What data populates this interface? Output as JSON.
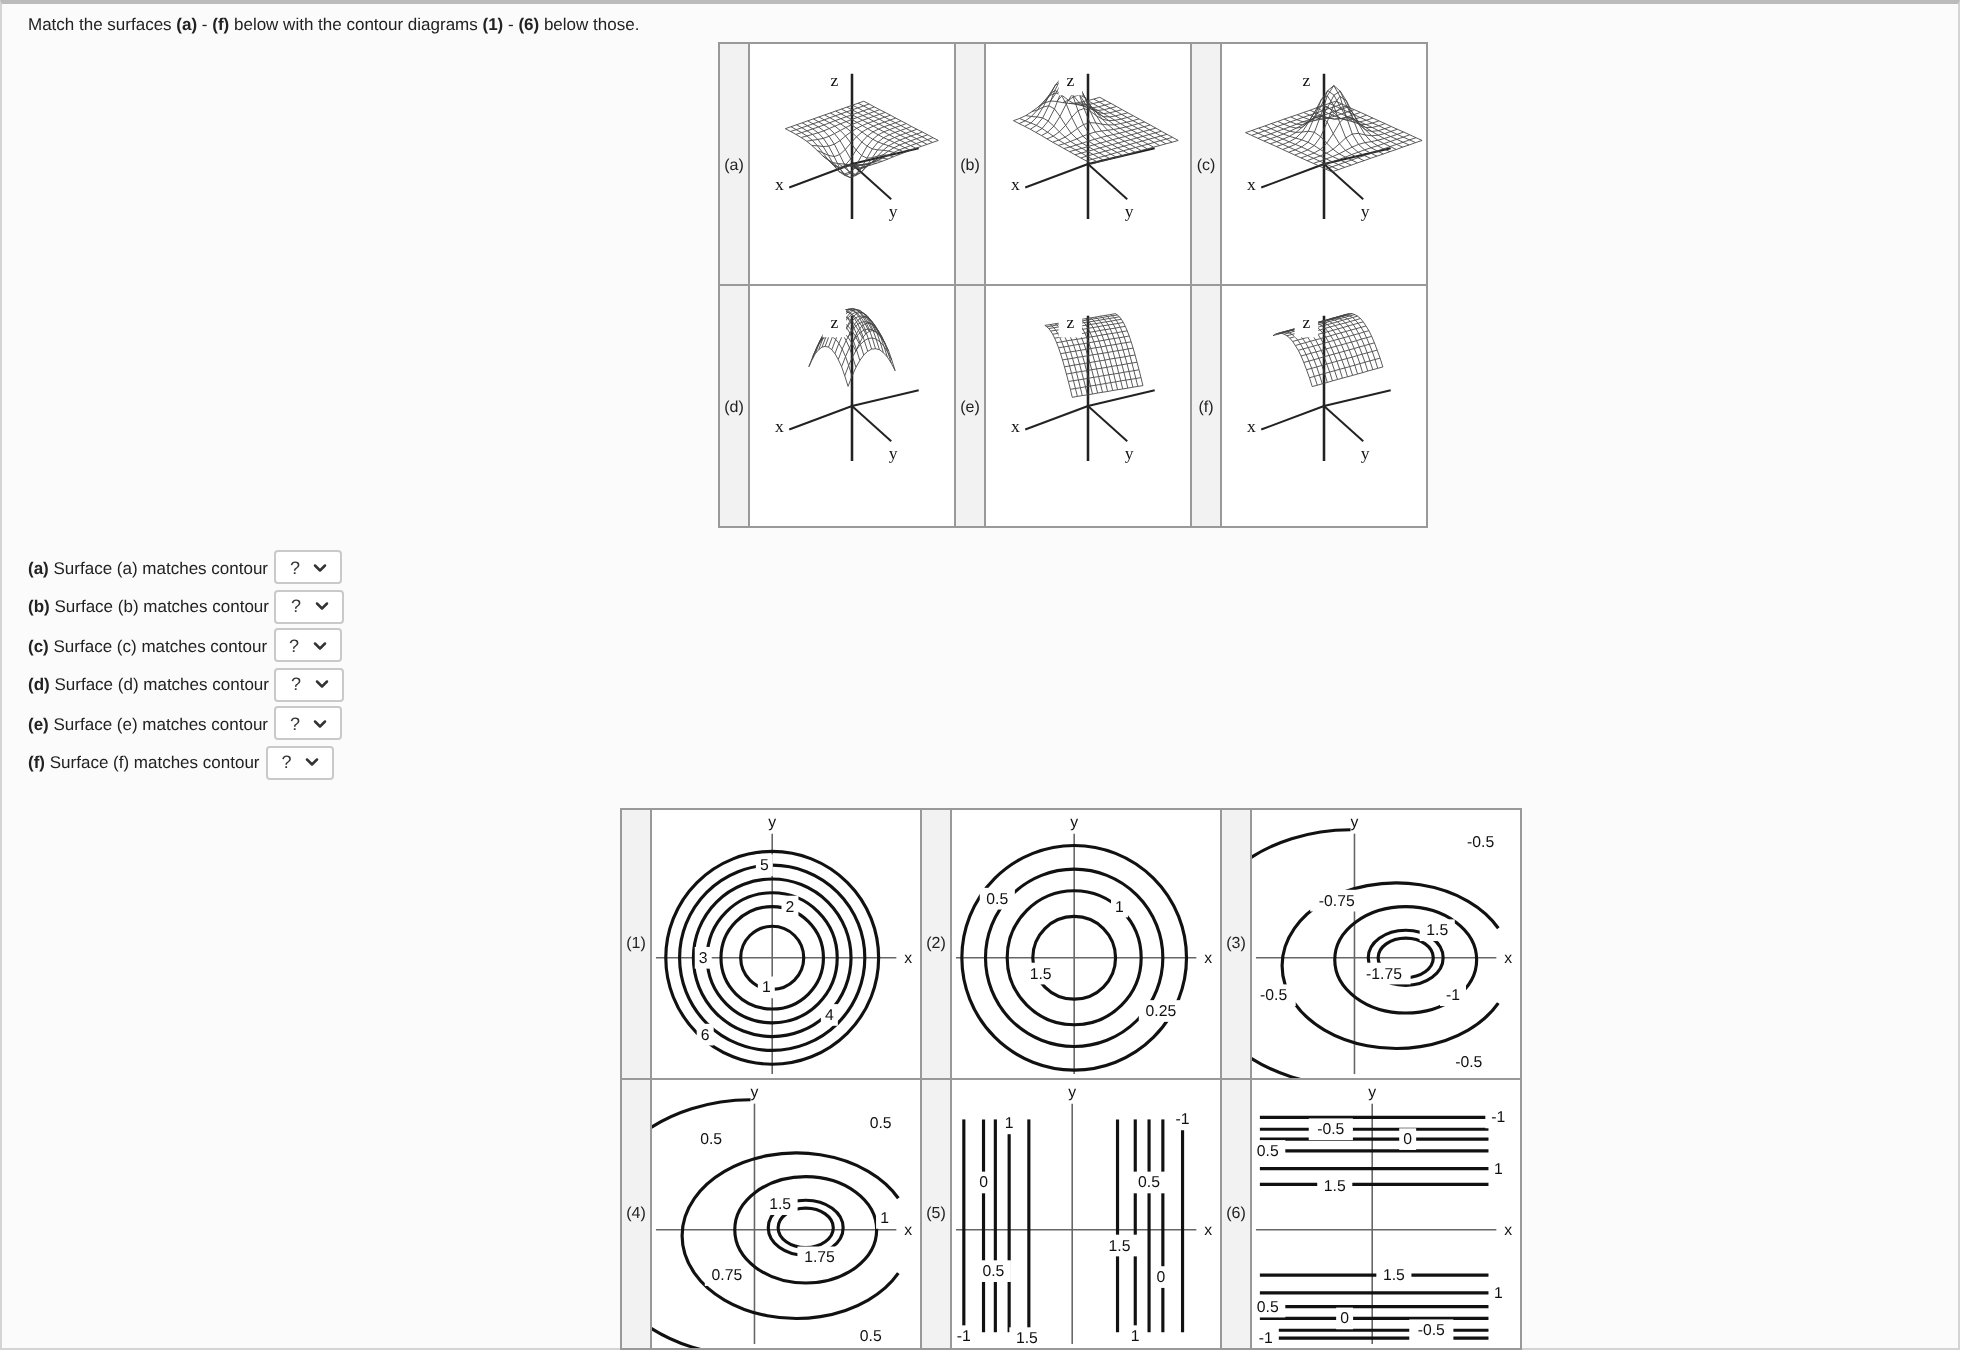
{
  "instruction": "Match the surfaces **(a)** - **(f)** below with the contour diagrams **(1)** - **(6)** below those.",
  "surfaces": [
    {
      "label": "(a)",
      "kind": "dip",
      "axis_labels": {
        "z": "z",
        "x": "x",
        "y": "y"
      }
    },
    {
      "label": "(b)",
      "kind": "offset-peak",
      "axis_labels": {
        "z": "z",
        "x": "x",
        "y": "y"
      }
    },
    {
      "label": "(c)",
      "kind": "peak",
      "axis_labels": {
        "z": "z",
        "x": "x",
        "y": "y"
      }
    },
    {
      "label": "(d)",
      "kind": "bowl",
      "axis_labels": {
        "z": "z",
        "x": "x",
        "y": "y"
      }
    },
    {
      "label": "(e)",
      "kind": "ridge",
      "axis_labels": {
        "z": "z",
        "x": "x",
        "y": "y"
      }
    },
    {
      "label": "(f)",
      "kind": "arch",
      "axis_labels": {
        "z": "z",
        "x": "x",
        "y": "y"
      }
    }
  ],
  "questions": [
    {
      "label": "(a)",
      "text": "Surface (a) matches contour",
      "value": "?"
    },
    {
      "label": "(b)",
      "text": "Surface (b) matches contour",
      "value": "?"
    },
    {
      "label": "(c)",
      "text": "Surface (c) matches contour",
      "value": "?"
    },
    {
      "label": "(d)",
      "text": "Surface (d) matches contour",
      "value": "?"
    },
    {
      "label": "(e)",
      "text": "Surface (e) matches contour",
      "value": "?"
    },
    {
      "label": "(f)",
      "text": "Surface (f) matches contour",
      "value": "?"
    }
  ],
  "contours": [
    {
      "label": "(1)",
      "kind": "rings",
      "axis_labels": {
        "x": "x",
        "y": "y"
      },
      "level_labels": [
        "5",
        "2",
        "3",
        "1",
        "4",
        "6"
      ]
    },
    {
      "label": "(2)",
      "kind": "wide-rings",
      "axis_labels": {
        "x": "x",
        "y": "y"
      },
      "level_labels": [
        "0.5",
        "1",
        "1.5",
        "0.25"
      ]
    },
    {
      "label": "(3)",
      "kind": "offset-ovals-low",
      "axis_labels": {
        "x": "x",
        "y": "y"
      },
      "level_labels": [
        "-0.5",
        "-0.75",
        "1.5",
        "-1.75",
        "-1",
        "-0.5",
        "-0.5"
      ]
    },
    {
      "label": "(4)",
      "kind": "offset-ovals-high",
      "axis_labels": {
        "x": "x",
        "y": "y"
      },
      "level_labels": [
        "0.5",
        "0.5",
        "1.5",
        "1.75",
        "1",
        "0.75",
        "0.5"
      ]
    },
    {
      "label": "(5)",
      "kind": "vertical-lines",
      "axis_labels": {
        "x": "x",
        "y": "y"
      },
      "level_labels": [
        "1",
        "0",
        "0.5",
        "-1",
        "1.5",
        "0.5",
        "1.5",
        "0",
        "1",
        "-1"
      ]
    },
    {
      "label": "(6)",
      "kind": "horizontal-lines",
      "axis_labels": {
        "x": "x",
        "y": "y"
      },
      "level_labels": [
        "-1",
        "-0.5",
        "0",
        "0.5",
        "1",
        "1.5",
        "1.5",
        "1",
        "0.5",
        "0",
        "-0.5",
        "-1"
      ]
    }
  ]
}
